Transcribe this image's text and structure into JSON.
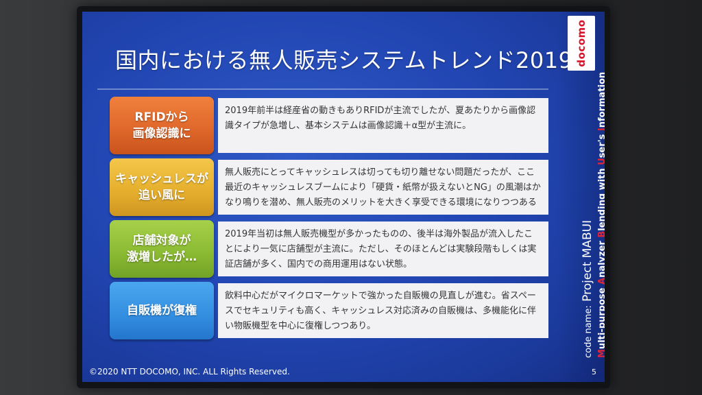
{
  "slide": {
    "title": "国内における無人販売システムトレンド2019",
    "logo_text": "docomo",
    "code_name_prefix": "code name:",
    "code_name": "Project MABUI",
    "subtitle_parts": [
      {
        "text": "M",
        "red": true
      },
      {
        "text": "ulti-purpose ",
        "red": false
      },
      {
        "text": "A",
        "red": true
      },
      {
        "text": "nalyzer ",
        "red": false
      },
      {
        "text": "B",
        "red": true
      },
      {
        "text": "lending with ",
        "red": false
      },
      {
        "text": "U",
        "red": true
      },
      {
        "text": "ser's ",
        "red": false
      },
      {
        "text": "I",
        "red": true
      },
      {
        "text": "nformation",
        "red": false
      }
    ],
    "rows": [
      {
        "label": "RFIDから\n画像認識に",
        "text": "2019年前半は経産省の動きもありRFIDが主流でしたが、夏あたりから画像認識タイプが急増し、基本システムは画像認識＋α型が主流に。"
      },
      {
        "label": "キャッシュレスが\n追い風に",
        "text": "無人販売にとってキャッシュレスは切っても切り離せない問題だったが、ここ最近のキャッシュレスブームにより「硬貨・紙幣が扱えないとNG」の風潮はかなり鳴りを潜め、無人販売のメリットを大きく享受できる環境になりつつある"
      },
      {
        "label": "店舗対象が\n激増したが…",
        "text": "2019年当初は無人販売機型が多かったものの、後半は海外製品が流入したことにより一気に店舗型が主流に。ただし、そのほとんどは実験段階もしくは実証店舗が多く、国内での商用運用はない状態。"
      },
      {
        "label": "自販機が復権",
        "text": "飲料中心だがマイクロマーケットで強かった自販機の見直しが進む。省スペースでセキュリティも高く、キャッシュレス対応済みの自販機は、多機能化に伴い物販機型を中心に復権しつつあり。"
      }
    ],
    "copyright": "©2020 NTT DOCOMO, INC. ALL Rights Reserved.",
    "page_number": "5"
  }
}
